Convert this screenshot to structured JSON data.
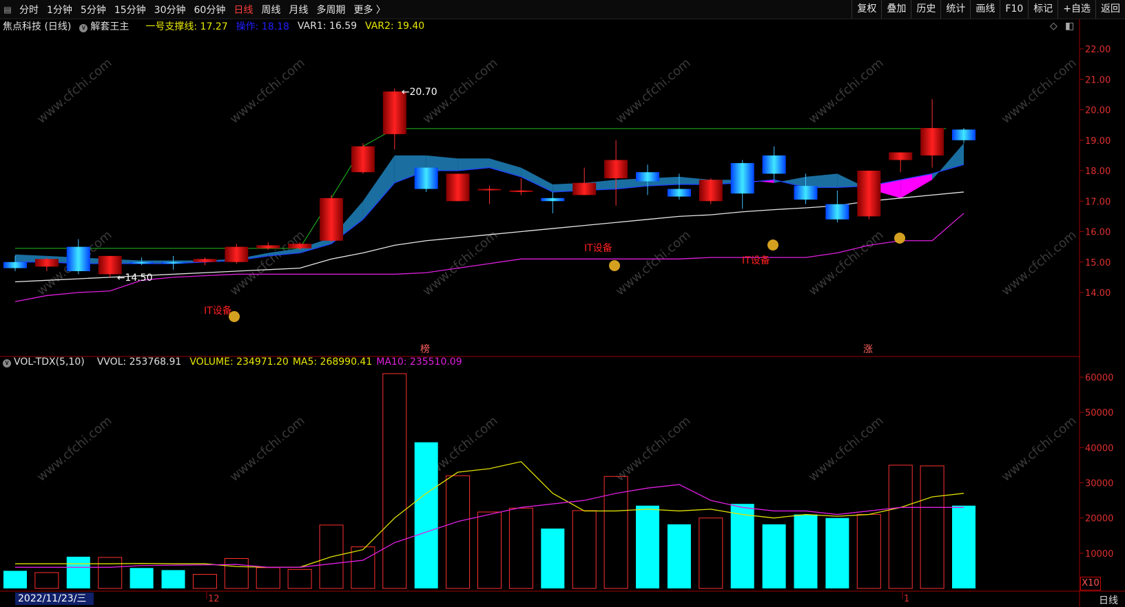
{
  "toolbar": {
    "timeframes": [
      "分时",
      "1分钟",
      "5分钟",
      "15分钟",
      "30分钟",
      "60分钟",
      "日线",
      "周线",
      "月线",
      "多周期",
      "更多 〉"
    ],
    "active_index": 6,
    "right_buttons": [
      "复权",
      "叠加",
      "历史",
      "统计",
      "画线",
      "F10",
      "标记",
      "+自选",
      "返回"
    ]
  },
  "main_header": {
    "stock": "焦点科技 (日线)",
    "indicator": "解套王主",
    "support_label": "一号支撑线: 17.27",
    "op_label": "操作: 18.18",
    "var1": "VAR1: 16.59",
    "var2": "VAR2: 19.40"
  },
  "vol_header": {
    "name": "VOL-TDX(5,10)",
    "vvol": "VVOL: 253768.91",
    "volume": "VOLUME: 234971.20",
    "ma5": "MA5: 268990.41",
    "ma10": "MA10: 235510.09"
  },
  "price_axis": [
    "22.00",
    "21.00",
    "20.00",
    "19.00",
    "18.00",
    "17.00",
    "16.00",
    "15.00",
    "14.00"
  ],
  "vol_axis": [
    "60000",
    "50000",
    "40000",
    "30000",
    "20000",
    "10000"
  ],
  "annotations": {
    "high_label": "←20.70",
    "low_label": "←14.50",
    "it1": "IT设备",
    "it2": "IT设备",
    "it3": "IT设备",
    "bang": "榜",
    "zhang": "涨",
    "x10": "X10"
  },
  "bottom": {
    "date": "2022/11/23/三",
    "month12": "12",
    "month1": "1",
    "period": "日线"
  },
  "watermark": "www.cfchi.com",
  "colors": {
    "up": "#ff2020",
    "down_fill": "#00d8ff",
    "ma5": "#e0e000",
    "ma10": "#e020e0",
    "white_line": "#e8e8e8",
    "green_line": "#20c020",
    "cloud_magenta": "#ff00ff",
    "cloud_blue": "#1a6fa0"
  },
  "chart_data": {
    "type": "candlestick",
    "price_range": [
      13.5,
      22.5
    ],
    "volume_unit_label": "X10",
    "volume_range": [
      0,
      62000
    ],
    "candles": [
      {
        "o": 15.0,
        "h": 15.2,
        "l": 14.7,
        "c": 14.8,
        "vol": 5000
      },
      {
        "o": 14.85,
        "h": 15.15,
        "l": 14.7,
        "c": 15.1,
        "vol": 4500
      },
      {
        "o": 15.5,
        "h": 15.75,
        "l": 14.6,
        "c": 14.7,
        "vol": 9000
      },
      {
        "o": 14.6,
        "h": 15.2,
        "l": 14.5,
        "c": 15.2,
        "vol": 8800
      },
      {
        "o": 15.0,
        "h": 15.15,
        "l": 14.9,
        "c": 14.95,
        "vol": 5800
      },
      {
        "o": 15.0,
        "h": 15.2,
        "l": 14.75,
        "c": 14.95,
        "vol": 5200
      },
      {
        "o": 15.0,
        "h": 15.15,
        "l": 14.9,
        "c": 15.1,
        "vol": 4000
      },
      {
        "o": 15.0,
        "h": 15.6,
        "l": 14.95,
        "c": 15.5,
        "vol": 8500
      },
      {
        "o": 15.45,
        "h": 15.65,
        "l": 15.4,
        "c": 15.55,
        "vol": 5900
      },
      {
        "o": 15.45,
        "h": 15.65,
        "l": 15.4,
        "c": 15.6,
        "vol": 5400
      },
      {
        "o": 15.7,
        "h": 17.2,
        "l": 15.65,
        "c": 17.1,
        "vol": 18000
      },
      {
        "o": 17.95,
        "h": 18.9,
        "l": 17.9,
        "c": 18.8,
        "vol": 11800
      },
      {
        "o": 19.2,
        "h": 20.7,
        "l": 18.7,
        "c": 20.6,
        "vol": 61000
      },
      {
        "o": 18.1,
        "h": 18.1,
        "l": 17.3,
        "c": 17.4,
        "vol": 41500
      },
      {
        "o": 17.0,
        "h": 17.9,
        "l": 17.0,
        "c": 17.9,
        "vol": 32000
      },
      {
        "o": 17.4,
        "h": 17.5,
        "l": 16.9,
        "c": 17.4,
        "vol": 21700
      },
      {
        "o": 17.3,
        "h": 17.75,
        "l": 17.2,
        "c": 17.35,
        "vol": 22800
      },
      {
        "o": 17.1,
        "h": 17.3,
        "l": 16.6,
        "c": 17.0,
        "vol": 17000
      },
      {
        "o": 17.2,
        "h": 18.1,
        "l": 17.2,
        "c": 17.6,
        "vol": 22100
      },
      {
        "o": 17.75,
        "h": 19.0,
        "l": 16.85,
        "c": 18.35,
        "vol": 31800
      },
      {
        "o": 17.95,
        "h": 18.2,
        "l": 17.2,
        "c": 17.65,
        "vol": 23500
      },
      {
        "o": 17.4,
        "h": 17.9,
        "l": 17.05,
        "c": 17.15,
        "vol": 18200
      },
      {
        "o": 17.0,
        "h": 17.75,
        "l": 16.9,
        "c": 17.7,
        "vol": 20000
      },
      {
        "o": 18.25,
        "h": 18.35,
        "l": 16.75,
        "c": 17.25,
        "vol": 24000
      },
      {
        "o": 18.5,
        "h": 18.8,
        "l": 17.7,
        "c": 17.9,
        "vol": 18200
      },
      {
        "o": 17.5,
        "h": 17.9,
        "l": 16.9,
        "c": 17.05,
        "vol": 21000
      },
      {
        "o": 16.9,
        "h": 17.35,
        "l": 16.3,
        "c": 16.4,
        "vol": 20000
      },
      {
        "o": 16.5,
        "h": 18.0,
        "l": 16.4,
        "c": 18.0,
        "vol": 21000
      },
      {
        "o": 18.35,
        "h": 18.55,
        "l": 17.95,
        "c": 18.6,
        "vol": 35000
      },
      {
        "o": 18.5,
        "h": 20.35,
        "l": 18.1,
        "c": 19.4,
        "vol": 34800
      },
      {
        "o": 19.35,
        "h": 19.4,
        "l": 18.9,
        "c": 19.0,
        "vol": 23500
      }
    ],
    "ma5": [
      7000,
      7000,
      7000,
      7000,
      7100,
      7000,
      7000,
      6200,
      6000,
      6000,
      9000,
      11000,
      20000,
      27000,
      33000,
      34000,
      36000,
      27000,
      22000,
      22000,
      22500,
      22000,
      22500,
      21000,
      20000,
      21000,
      20500,
      21000,
      23000,
      26000,
      27000
    ],
    "ma10": [
      6000,
      6000,
      6000,
      6000,
      6500,
      6600,
      6700,
      6800,
      6000,
      6000,
      7000,
      8000,
      13000,
      16000,
      19000,
      21000,
      23000,
      24000,
      25000,
      27000,
      28500,
      29500,
      25000,
      23000,
      22000,
      22000,
      21000,
      22000,
      23000,
      23000,
      23000
    ],
    "white_line": [
      14.35,
      14.4,
      14.45,
      14.5,
      14.55,
      14.6,
      14.65,
      14.7,
      14.75,
      14.8,
      15.1,
      15.3,
      15.55,
      15.7,
      15.8,
      15.9,
      16.0,
      16.1,
      16.2,
      16.3,
      16.4,
      16.5,
      16.55,
      16.65,
      16.72,
      16.78,
      16.85,
      17.0,
      17.1,
      17.2,
      17.3
    ],
    "purple_line": [
      13.7,
      13.9,
      14.0,
      14.05,
      14.4,
      14.5,
      14.55,
      14.6,
      14.6,
      14.6,
      14.6,
      14.6,
      14.6,
      14.65,
      14.8,
      14.95,
      15.1,
      15.1,
      15.1,
      15.1,
      15.1,
      15.1,
      15.15,
      15.15,
      15.15,
      15.15,
      15.3,
      15.55,
      15.7,
      15.7,
      16.6
    ],
    "blue_line": [
      15.0,
      15.0,
      14.95,
      14.95,
      14.95,
      14.95,
      15.0,
      15.05,
      15.2,
      15.3,
      15.6,
      16.4,
      17.6,
      18.0,
      18.0,
      18.1,
      17.8,
      17.3,
      17.35,
      17.4,
      17.5,
      17.55,
      17.55,
      17.6,
      17.7,
      17.45,
      17.45,
      17.5,
      17.7,
      17.9,
      18.2
    ]
  }
}
